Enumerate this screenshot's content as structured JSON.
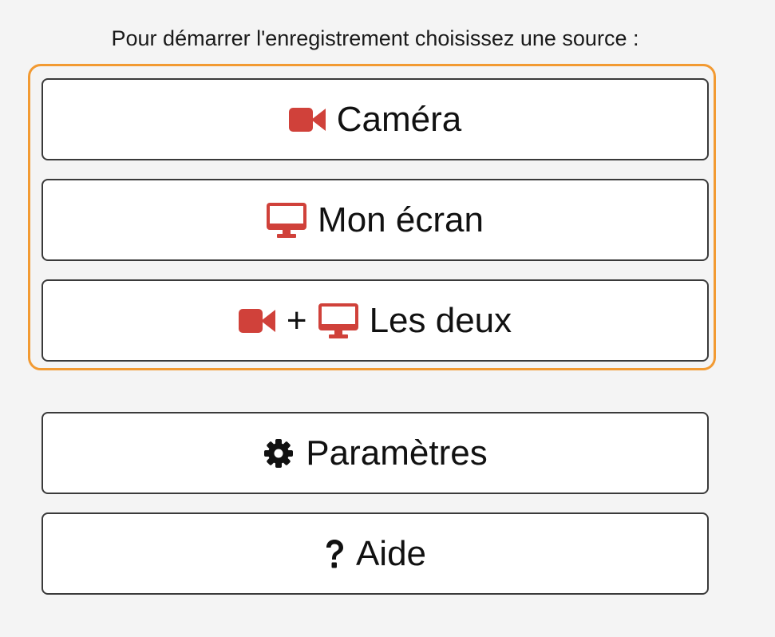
{
  "prompt": {
    "text": "Pour démarrer l'enregistrement choisissez une source :"
  },
  "sources": {
    "camera_label": "Caméra",
    "screen_label": "Mon écran",
    "both_plus": "+",
    "both_label": "Les deux",
    "group_border_color": "#f29a32"
  },
  "actions": {
    "settings_label": "Paramètres",
    "help_label": "Aide"
  },
  "icons": {
    "camera": "video-camera-icon",
    "screen": "desktop-monitor-icon",
    "settings": "gear-icon",
    "help": "question-mark-icon",
    "accent_color": "#d0413a"
  }
}
